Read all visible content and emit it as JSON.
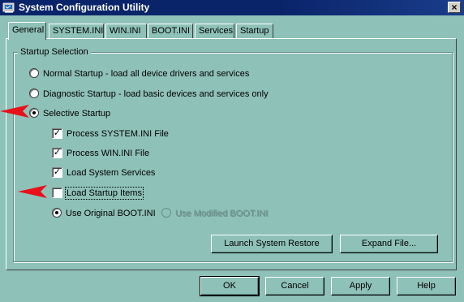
{
  "window": {
    "title": "System Configuration Utility",
    "close_glyph": "×"
  },
  "tabs": [
    {
      "label": "General",
      "active": true
    },
    {
      "label": "SYSTEM.INI",
      "active": false
    },
    {
      "label": "WIN.INI",
      "active": false
    },
    {
      "label": "BOOT.INI",
      "active": false
    },
    {
      "label": "Services",
      "active": false
    },
    {
      "label": "Startup",
      "active": false
    }
  ],
  "startup_selection": {
    "legend": "Startup Selection",
    "radios": [
      {
        "label": "Normal Startup - load all device drivers and services",
        "selected": false
      },
      {
        "label": "Diagnostic Startup - load basic devices and services only",
        "selected": false
      },
      {
        "label": "Selective Startup",
        "selected": true
      }
    ],
    "checkboxes": [
      {
        "label": "Process SYSTEM.INI File",
        "checked": true
      },
      {
        "label": "Process WIN.INI File",
        "checked": true
      },
      {
        "label": "Load System Services",
        "checked": true
      },
      {
        "label": "Load Startup Items",
        "checked": false
      }
    ],
    "boot_ini": [
      {
        "label": "Use Original BOOT.INI",
        "selected": true,
        "enabled": true
      },
      {
        "label": "Use Modified BOOT.INI",
        "selected": false,
        "enabled": false
      }
    ],
    "launch_restore_label": "Launch System Restore",
    "expand_file_label": "Expand File..."
  },
  "footer": {
    "ok_label": "OK",
    "cancel_label": "Cancel",
    "apply_label": "Apply",
    "help_label": "Help"
  },
  "colors": {
    "dialog_background": "#8ec1b8",
    "titlebar": "#0a246a",
    "annotation_arrow": "#e8101a"
  },
  "annotations": [
    {
      "points_to": "selective-startup-radio"
    },
    {
      "points_to": "load-startup-items-checkbox"
    }
  ]
}
